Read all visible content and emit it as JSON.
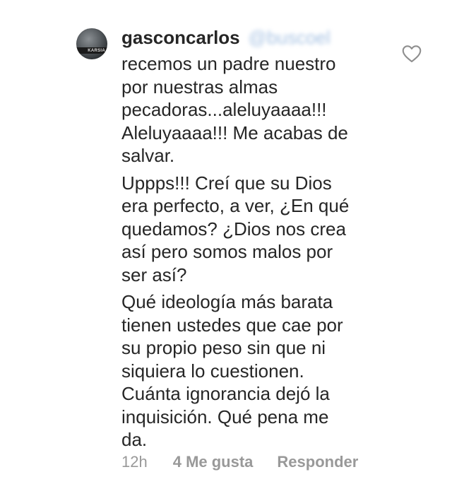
{
  "comment": {
    "username": "gasconcarlos",
    "mention": "@buscoel",
    "paragraphs": [
      "recemos un padre nuestro\npor nuestras almas\npecadoras...aleluyaaaa!!!\nAleluyaaaa!!! Me acabas de\nsalvar.",
      "Uppps!!! Creí que su Dios\nera perfecto, a ver, ¿En qué\nquedamos? ¿Dios nos crea\nasí pero somos malos por\nser así?",
      "Qué ideología más barata\ntienen ustedes que cae por\nsu propio peso sin que ni\nsiquiera lo cuestionen.\nCuánta ignorancia dejó la\ninquisición. Qué pena me\nda."
    ],
    "avatar_text": "KARSIA",
    "time": "12h",
    "likes": "4 Me gusta",
    "reply_label": "Responder",
    "like_icon": "heart-outline-icon"
  },
  "colors": {
    "text": "#262626",
    "meta": "#999999",
    "mention_blurred": "#a9c4e4"
  }
}
